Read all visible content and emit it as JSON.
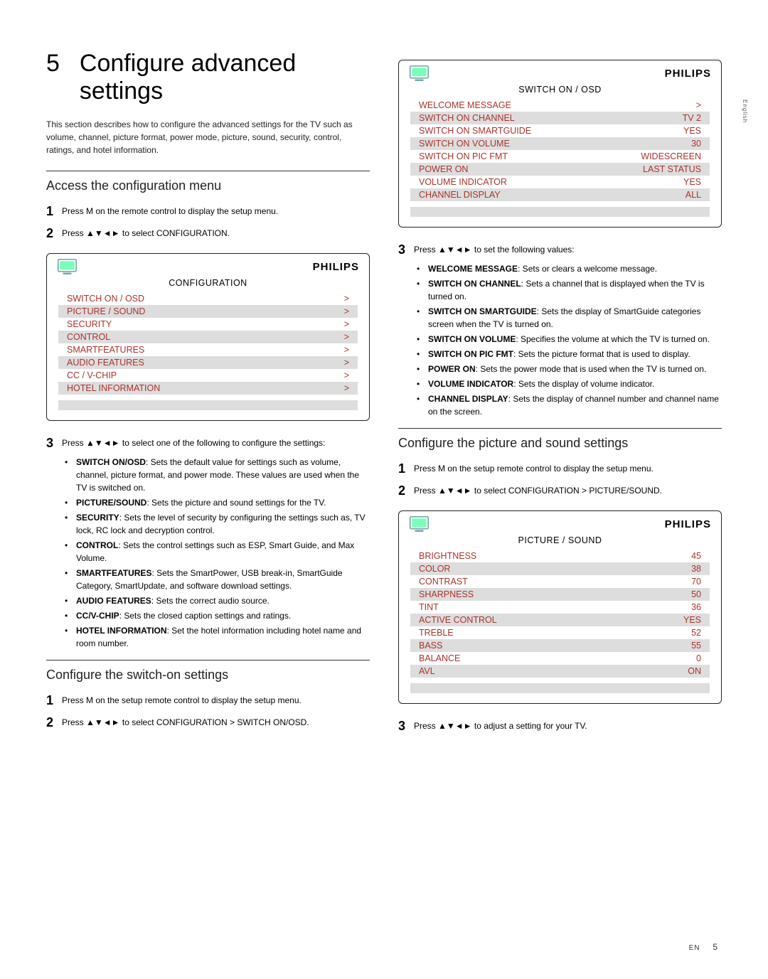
{
  "lang_tab": "English",
  "chapter": {
    "num": "5",
    "title": "Configure advanced settings"
  },
  "intro": "This section describes how to configure the advanced settings for the TV such as volume, channel, picture format, power mode, picture, sound, security, control, ratings, and hotel information.",
  "brand": "PHILIPS",
  "arrows": "▲▼◄►",
  "section_access": {
    "title": "Access the configuration menu",
    "s1": "Press M on the remote control to display the setup menu.",
    "s2_pre": "Press ",
    "s2_post": " to select CONFIGURATION.",
    "osd_title": "CONFIGURATION",
    "items": [
      {
        "label": "SWITCH ON / OSD",
        "value": ">"
      },
      {
        "label": "PICTURE / SOUND",
        "value": ">"
      },
      {
        "label": "SECURITY",
        "value": ">"
      },
      {
        "label": "CONTROL",
        "value": ">"
      },
      {
        "label": "SMARTFEATURES",
        "value": ">"
      },
      {
        "label": "AUDIO FEATURES",
        "value": ">"
      },
      {
        "label": "CC / V-CHIP",
        "value": ">"
      },
      {
        "label": "HOTEL INFORMATION",
        "value": ">"
      }
    ],
    "s3_pre": "Press ",
    "s3_post": " to select one of the following to configure the settings:",
    "bullets": [
      {
        "b": "SWITCH ON/OSD",
        "t": ": Sets the default value for settings such as volume, channel, picture format, and power mode. These values are used when the TV is switched on."
      },
      {
        "b": "PICTURE/SOUND",
        "t": ": Sets the picture and sound settings for the TV."
      },
      {
        "b": "SECURITY",
        "t": ": Sets the level of security by configuring the settings such as, TV lock, RC lock and decryption control."
      },
      {
        "b": "CONTROL",
        "t": ": Sets the control settings such as ESP, Smart Guide, and Max Volume."
      },
      {
        "b": "SMARTFEATURES",
        "t": ": Sets the SmartPower, USB break-in, SmartGuide Category, SmartUpdate, and software download settings."
      },
      {
        "b": "AUDIO FEATURES",
        "t": ": Sets the correct audio source."
      },
      {
        "b": "CC/V-CHIP",
        "t": ": Sets the closed caption settings and ratings."
      },
      {
        "b": "HOTEL INFORMATION",
        "t": ": Set the hotel information including hotel name and room number."
      }
    ]
  },
  "section_switchon": {
    "title": "Configure the switch-on settings",
    "s1": "Press M on the setup remote control to display the setup menu.",
    "s2_pre": "Press ",
    "s2_post": " to select CONFIGURATION > SWITCH ON/OSD.",
    "osd_title": "SWITCH ON / OSD",
    "items": [
      {
        "label": "WELCOME MESSAGE",
        "value": ">"
      },
      {
        "label": "SWITCH ON CHANNEL",
        "value": "TV 2"
      },
      {
        "label": "SWITCH ON SMARTGUIDE",
        "value": "YES"
      },
      {
        "label": "SWITCH ON VOLUME",
        "value": "30"
      },
      {
        "label": "SWITCH ON PIC FMT",
        "value": "WIDESCREEN"
      },
      {
        "label": "POWER ON",
        "value": "LAST STATUS"
      },
      {
        "label": "VOLUME INDICATOR",
        "value": "YES"
      },
      {
        "label": "CHANNEL DISPLAY",
        "value": "ALL"
      }
    ],
    "s3_pre": "Press ",
    "s3_post": " to set the following values:",
    "bullets": [
      {
        "b": "WELCOME MESSAGE",
        "t": ": Sets or clears a welcome message."
      },
      {
        "b": "SWITCH ON CHANNEL",
        "t": ": Sets a channel that is displayed when the TV is turned on."
      },
      {
        "b": "SWITCH ON SMARTGUIDE",
        "t": ": Sets the display of SmartGuide categories screen when the TV is turned on."
      },
      {
        "b": "SWITCH ON VOLUME",
        "t": ": Specifies the volume at which the TV is turned on."
      },
      {
        "b": "SWITCH ON PIC FMT",
        "t": ": Sets the picture format that is used to display."
      },
      {
        "b": "POWER ON",
        "t": ": Sets the power mode that is used when the TV is turned on."
      },
      {
        "b": "VOLUME INDICATOR",
        "t": ": Sets the display of volume indicator."
      },
      {
        "b": "CHANNEL DISPLAY",
        "t": ": Sets the display of channel number and channel name on the screen."
      }
    ]
  },
  "section_picture": {
    "title": "Configure the picture and sound settings",
    "s1": "Press M on the setup remote control to display the setup menu.",
    "s2_pre": "Press ",
    "s2_post": " to select CONFIGURATION > PICTURE/SOUND.",
    "osd_title": "PICTURE / SOUND",
    "items": [
      {
        "label": "BRIGHTNESS",
        "value": "45"
      },
      {
        "label": "COLOR",
        "value": "38"
      },
      {
        "label": "CONTRAST",
        "value": "70"
      },
      {
        "label": "SHARPNESS",
        "value": "50"
      },
      {
        "label": "TINT",
        "value": "36"
      },
      {
        "label": "ACTIVE CONTROL",
        "value": "YES"
      },
      {
        "label": "TREBLE",
        "value": "52"
      },
      {
        "label": "BASS",
        "value": "55"
      },
      {
        "label": "BALANCE",
        "value": "0"
      },
      {
        "label": "AVL",
        "value": "ON"
      }
    ],
    "s3_pre": "Press ",
    "s3_post": " to adjust a setting for your TV."
  },
  "footer": {
    "lang": "EN",
    "page": "5"
  }
}
